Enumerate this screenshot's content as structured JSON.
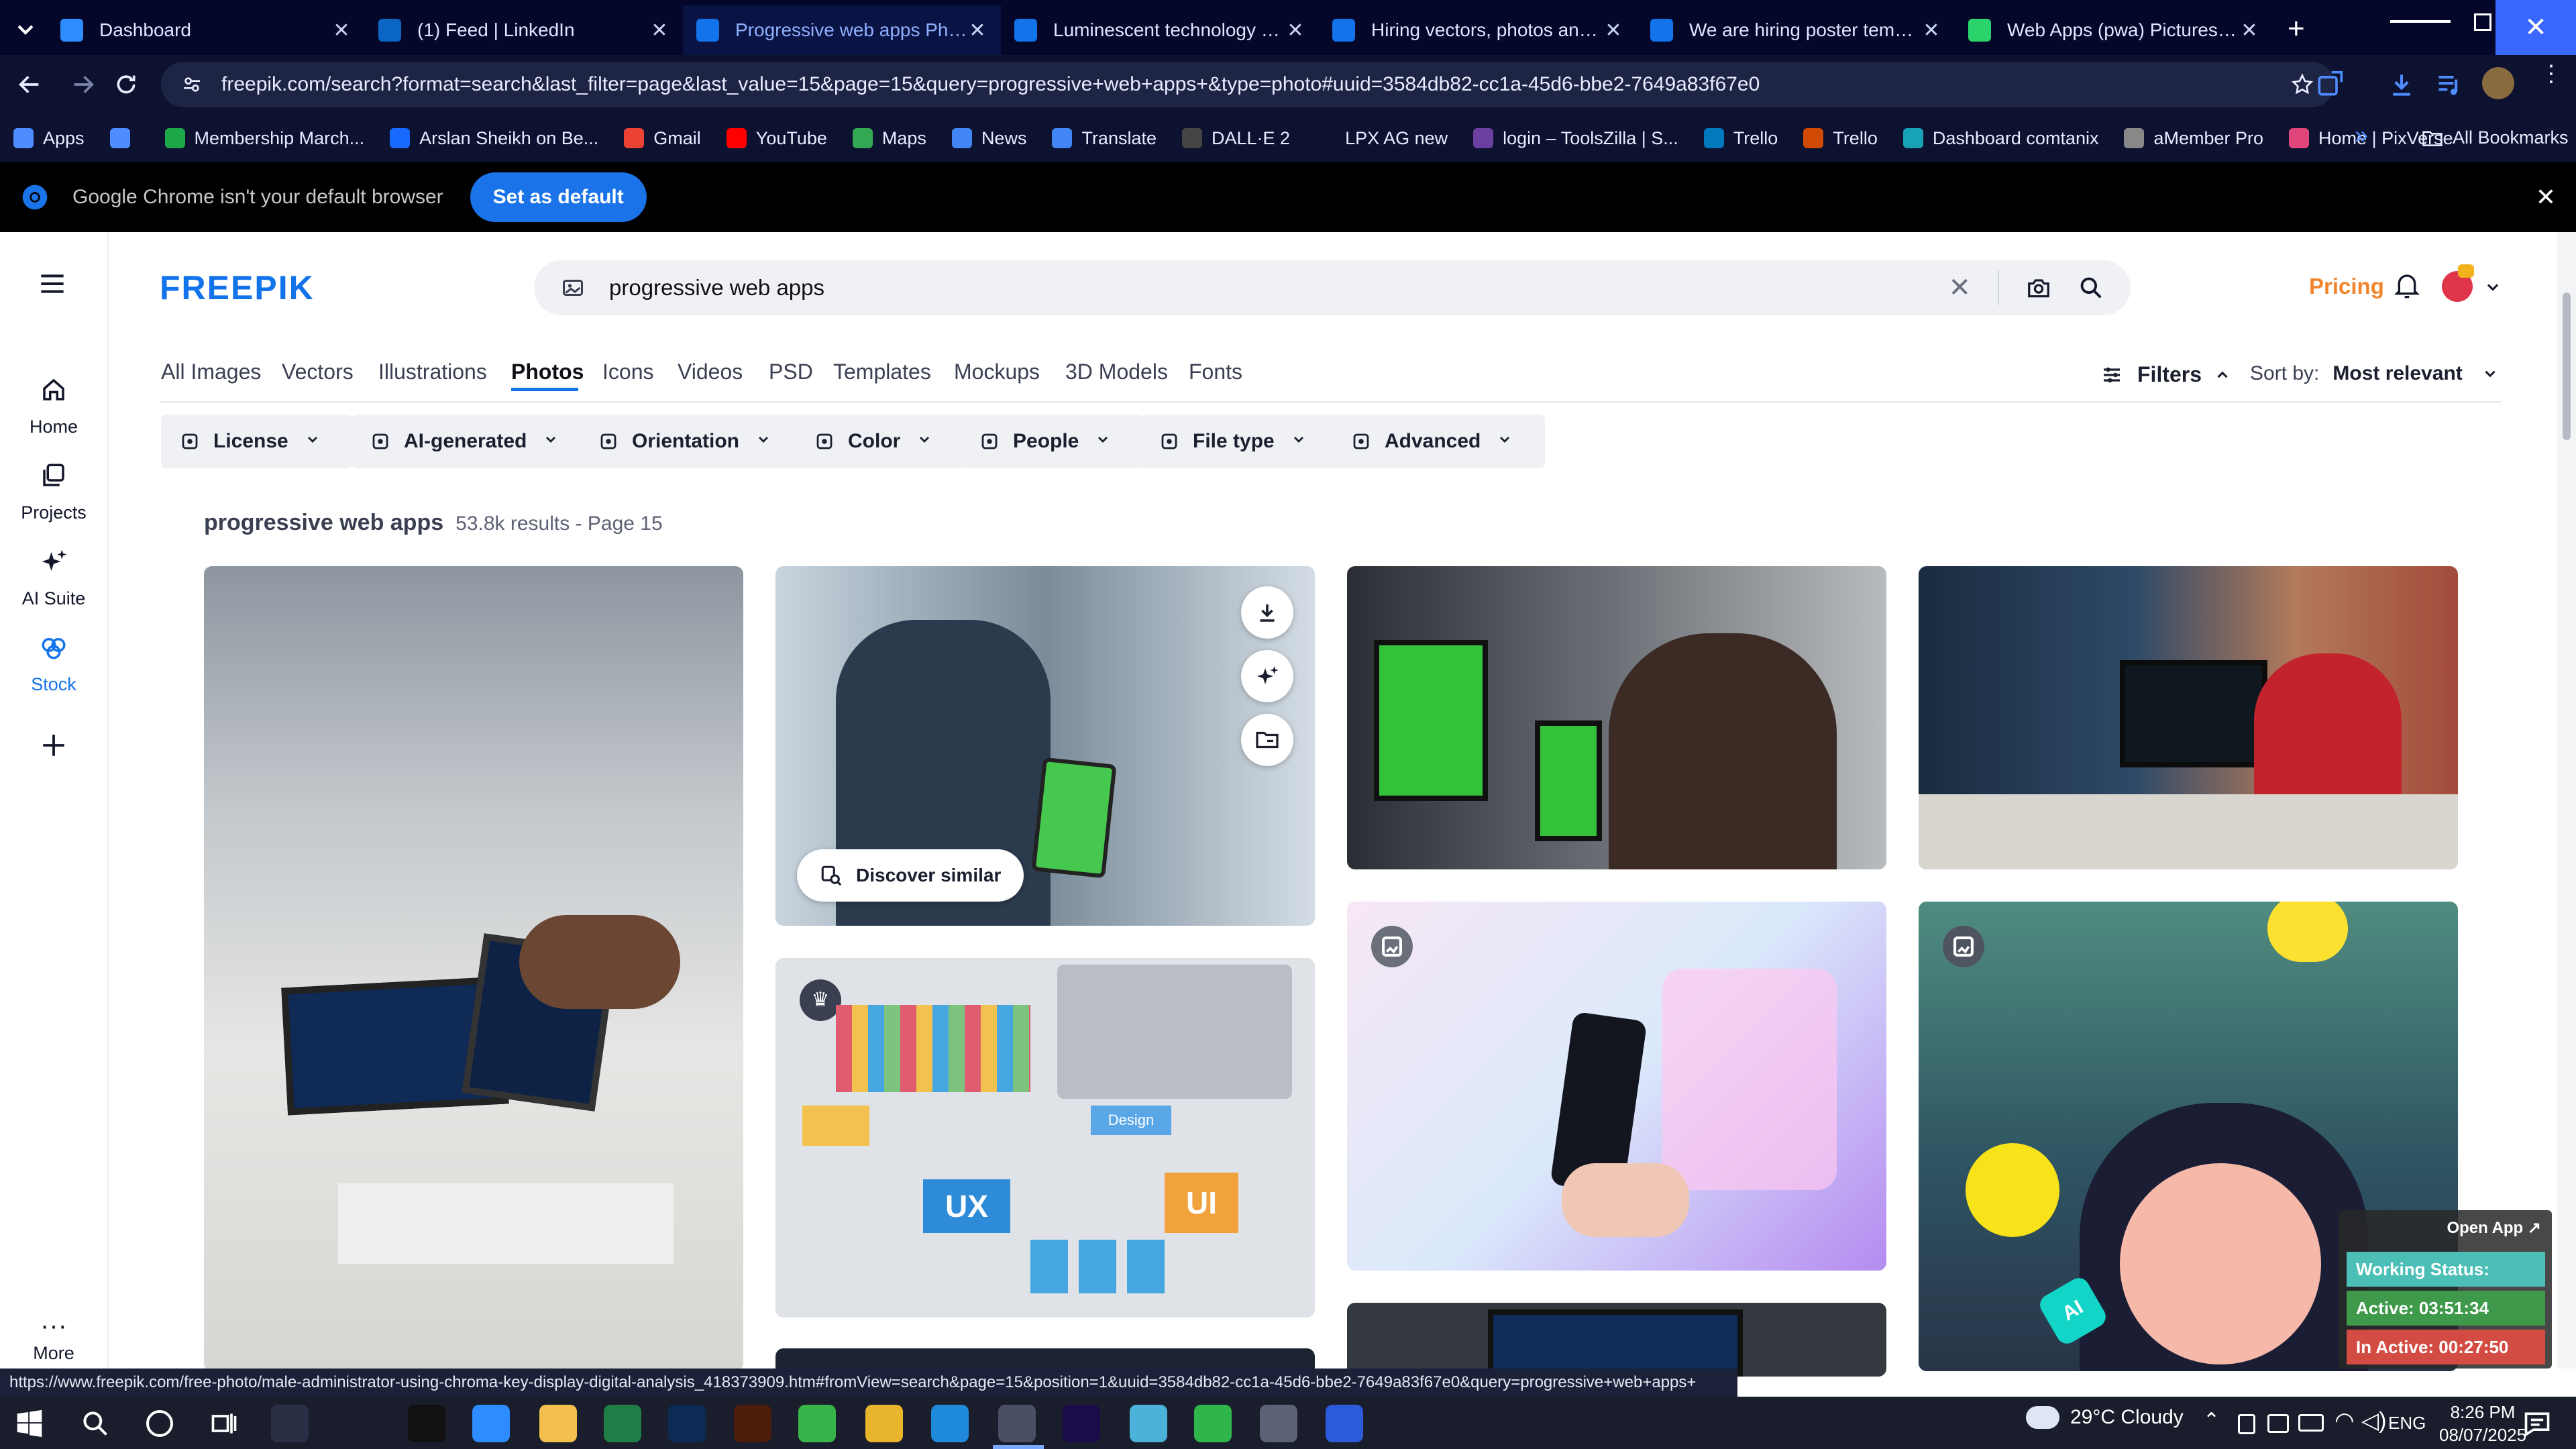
{
  "browser": {
    "tabs": [
      {
        "title": "Dashboard",
        "icon": "dashboard-favicon",
        "color": "#2d8cff"
      },
      {
        "title": "(1) Feed | LinkedIn",
        "icon": "linkedin-favicon",
        "color": "#0a66c2"
      },
      {
        "title": "Progressive web apps Photos |",
        "icon": "freepik-favicon",
        "color": "#1273eb"
      },
      {
        "title": "Luminescent technology and a",
        "icon": "freepik-favicon",
        "color": "#1273eb"
      },
      {
        "title": "Hiring vectors, photos and PSD",
        "icon": "freepik-favicon",
        "color": "#1273eb"
      },
      {
        "title": "We are hiring poster template",
        "icon": "freepik-favicon",
        "color": "#1273eb"
      },
      {
        "title": "Web Apps (pwa) Pictures, Imag",
        "icon": "web-apps-favicon",
        "color": "#2bd46b"
      }
    ],
    "url": "freepik.com/search?format=search&last_filter=page&last_value=15&page=15&query=progressive+web+apps+&type=photo#uuid=3584db82-cc1a-45d6-bbe2-7649a83f67e0",
    "bookmarks": [
      {
        "label": "Apps",
        "color": "#4f8cff"
      },
      {
        "label": "",
        "color": "#4f8cff"
      },
      {
        "label": "Membership March...",
        "color": "#1fa84a"
      },
      {
        "label": "Arslan Sheikh on Be...",
        "color": "#1769ff"
      },
      {
        "label": "Gmail",
        "color": "#ea4335"
      },
      {
        "label": "YouTube",
        "color": "#ff0000"
      },
      {
        "label": "Maps",
        "color": "#34a853"
      },
      {
        "label": "News",
        "color": "#4285f4"
      },
      {
        "label": "Translate",
        "color": "#4285f4"
      },
      {
        "label": "DALL·E 2",
        "color": "#444444"
      },
      {
        "label": "LPX AG new",
        "color": "#0c1230"
      },
      {
        "label": "login – ToolsZilla | S...",
        "color": "#6b3fa0"
      },
      {
        "label": "Trello",
        "color": "#0079bf"
      },
      {
        "label": "Trello",
        "color": "#d04a02"
      },
      {
        "label": "Dashboard comtanix",
        "color": "#17a2b8"
      },
      {
        "label": "aMember Pro",
        "color": "#888888"
      },
      {
        "label": "Home | PixVerse",
        "color": "#e0457b"
      }
    ],
    "all_bookmarks": "All Bookmarks",
    "infobar_message": "Google Chrome isn't your default browser",
    "infobar_button": "Set as default",
    "status_url": "https://www.freepik.com/free-photo/male-administrator-using-chroma-key-display-digital-analysis_418373909.htm#fromView=search&page=15&position=1&uuid=3584db82-cc1a-45d6-bbe2-7649a83f67e0&query=progressive+web+apps+"
  },
  "sidebar": {
    "items": [
      {
        "label": "Home",
        "icon": "home-icon"
      },
      {
        "label": "Projects",
        "icon": "projects-icon"
      },
      {
        "label": "AI Suite",
        "icon": "ai-suite-icon"
      },
      {
        "label": "Stock",
        "icon": "stock-icon"
      },
      {
        "label": "",
        "icon": "plus-icon"
      }
    ],
    "more": "More"
  },
  "header": {
    "logo": "FREEPIK",
    "search_value": "progressive web apps",
    "pricing": "Pricing"
  },
  "categories": [
    "All Images",
    "Vectors",
    "Illustrations",
    "Photos",
    "Icons",
    "Videos",
    "PSD",
    "Templates",
    "Mockups",
    "3D Models",
    "Fonts"
  ],
  "active_category": "Photos",
  "filters_label": "Filters",
  "sort": {
    "label": "Sort by:",
    "value": "Most relevant"
  },
  "filter_chips": [
    {
      "label": "License",
      "icon": "license-icon"
    },
    {
      "label": "AI-generated",
      "icon": "ai-generated-icon"
    },
    {
      "label": "Orientation",
      "icon": "orientation-icon"
    },
    {
      "label": "Color",
      "icon": "color-icon"
    },
    {
      "label": "People",
      "icon": "people-icon"
    },
    {
      "label": "File type",
      "icon": "file-type-icon"
    },
    {
      "label": "Advanced",
      "icon": "advanced-icon"
    }
  ],
  "results": {
    "query": "progressive web apps",
    "summary": "53.8k results - Page 15"
  },
  "card": {
    "discover_similar": "Discover similar"
  },
  "thumbnails": {
    "ux_tiles": [
      "UX",
      "UI",
      "Design"
    ],
    "ai_badge": "AI"
  },
  "widget": {
    "open_app": "Open App ↗",
    "working_status": "Working Status: Active",
    "active": "Active: 03:51:34",
    "inactive": "In Active: 00:27:50"
  },
  "taskbar": {
    "weather": "29°C  Cloudy",
    "language": "ENG",
    "time": "8:26 PM",
    "date": "08/07/2025"
  }
}
